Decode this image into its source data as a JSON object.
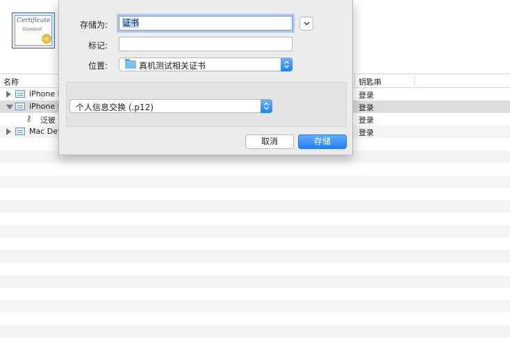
{
  "dialog": {
    "save_as_label": "存储为:",
    "save_as_value": "证书",
    "tags_label": "标记:",
    "tags_value": "",
    "location_label": "位置:",
    "location_value": "真机测试相关证书",
    "format_value": "个人信息交换 (.p12)",
    "cancel_label": "取消",
    "save_label": "存储"
  },
  "list": {
    "columns": {
      "name": "名称",
      "keychain": "钥匙串"
    },
    "rows": [
      {
        "name": "iPhone D",
        "keychain": "登录",
        "kind": "cert",
        "expander": "right"
      },
      {
        "name": "iPhone D",
        "keychain": "登录",
        "kind": "cert",
        "expander": "down"
      },
      {
        "name": "泛彼  ",
        "keychain": "登录",
        "kind": "key",
        "expander": "none"
      },
      {
        "name": "Mac Dev",
        "keychain": "登录",
        "kind": "cert",
        "expander": "right"
      }
    ]
  },
  "colors": {
    "accent": "#1f7ef7",
    "selection_row": "#dcdcdc",
    "focus_ring": "#6fa3e8"
  },
  "icons": {
    "certificate": "certificate-icon",
    "key": "key-icon",
    "folder": "folder-icon"
  }
}
